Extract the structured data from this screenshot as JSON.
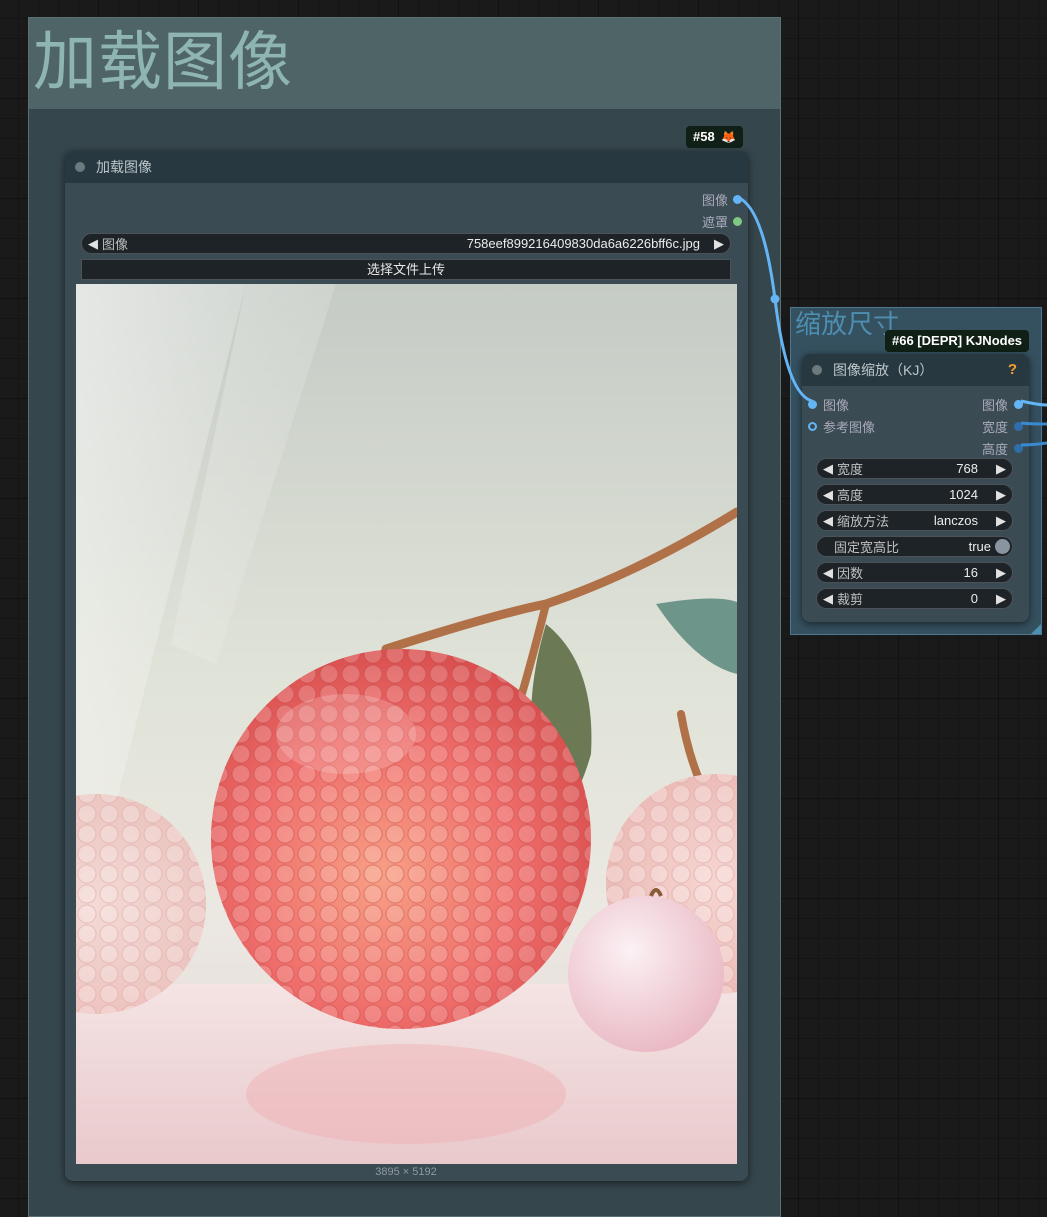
{
  "colors": {
    "canvas": "#1a1a1a",
    "group_bg": "#35464c",
    "group_title_bg": "#4e6466",
    "group_title_text": "#8fb5b2",
    "node_body": "#3a4b53",
    "node_header": "#283840",
    "link_image": "#64b5f6",
    "slot_image": "#64b5f6",
    "slot_mask": "#81c784",
    "slot_int": "#2f6ea8",
    "help": "#f4a02a"
  },
  "group_load": {
    "title": "加载图像"
  },
  "group_resize": {
    "title": "缩放尺寸"
  },
  "node_load": {
    "badge": "#58",
    "badge_icon": "fox-icon",
    "badge_icon_glyph": "🦊",
    "title": "加载图像",
    "outputs": [
      {
        "label": "图像",
        "type": "IMAGE"
      },
      {
        "label": "遮罩",
        "type": "MASK"
      }
    ],
    "image_widget": {
      "label": "图像",
      "value": "758eef899216409830da6a6226bff6c.jpg"
    },
    "upload_button": "选择文件上传",
    "preview_dims": "3895 × 5192"
  },
  "node_resize": {
    "badge": "#66 [DEPR] KJNodes",
    "title": "图像缩放（KJ）",
    "help_icon": "?",
    "inputs": [
      {
        "label": "图像"
      },
      {
        "label": "参考图像"
      }
    ],
    "outputs": [
      {
        "label": "图像"
      },
      {
        "label": "宽度"
      },
      {
        "label": "高度"
      }
    ],
    "widgets": [
      {
        "label": "宽度",
        "value": "768"
      },
      {
        "label": "高度",
        "value": "1024"
      },
      {
        "label": "缩放方法",
        "value": "lanczos"
      },
      {
        "label": "固定宽高比",
        "value": "true",
        "kind": "toggle"
      },
      {
        "label": "因数",
        "value": "16"
      },
      {
        "label": "裁剪",
        "value": "0"
      }
    ]
  }
}
